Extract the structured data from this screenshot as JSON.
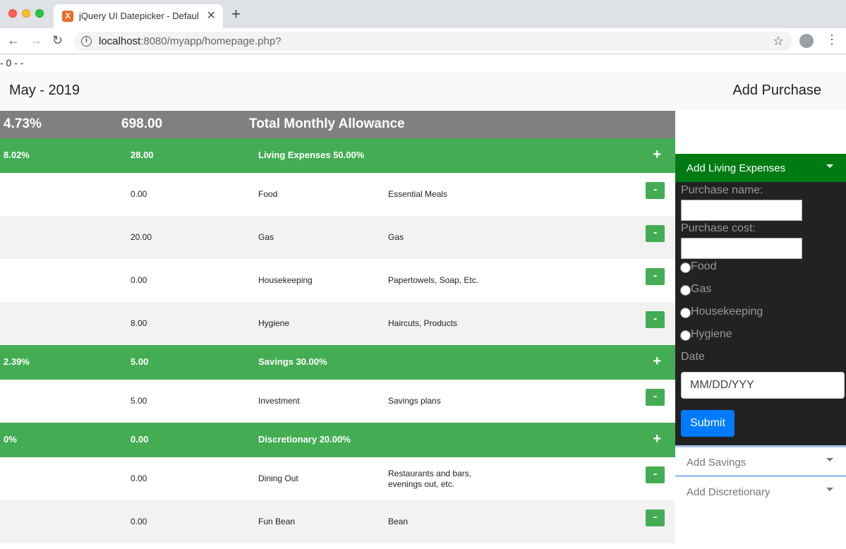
{
  "browser": {
    "tab_title": "jQuery UI Datepicker - Default f",
    "tab_favicon": "X",
    "url_host": "localhost",
    "url_path": ":8080/myapp/homepage.php?"
  },
  "page": {
    "top_text": "- 0 - -",
    "month": "May - 2019",
    "add_purchase": "Add Purchase"
  },
  "total": {
    "percent": "4.73%",
    "amount": "698.00",
    "label": "Total Monthly Allowance"
  },
  "categories": [
    {
      "percent": "8.02%",
      "amount": "28.00",
      "label": "Living Expenses 50.00%",
      "plus": "+",
      "items": [
        {
          "amount": "0.00",
          "name": "Food",
          "desc": "Essential Meals",
          "minus": "-"
        },
        {
          "amount": "20.00",
          "name": "Gas",
          "desc": "Gas",
          "minus": "-"
        },
        {
          "amount": "0.00",
          "name": "Housekeeping",
          "desc": "Papertowels, Soap, Etc.",
          "minus": "-"
        },
        {
          "amount": "8.00",
          "name": "Hygiene",
          "desc": "Haircuts, Products",
          "minus": "-"
        }
      ]
    },
    {
      "percent": "2.39%",
      "amount": "5.00",
      "label": "Savings 30.00%",
      "plus": "+",
      "items": [
        {
          "amount": "5.00",
          "name": "Investment",
          "desc": "Savings plans",
          "minus": "-"
        }
      ]
    },
    {
      "percent": "0%",
      "amount": "0.00",
      "label": "Discretionary 20.00%",
      "plus": "+",
      "items": [
        {
          "amount": "0.00",
          "name": "Dining Out",
          "desc_line1": "Restaurants and bars,",
          "desc_line2": "evenings out, etc.",
          "minus": "-"
        },
        {
          "amount": "0.00",
          "name": "Fun Bean",
          "desc": "Bean",
          "minus": "-"
        }
      ]
    }
  ],
  "sidebar": {
    "active_header": "Add Living Expenses",
    "purchase_name_label": "Purchase name:",
    "purchase_name_value": "",
    "purchase_cost_label": "Purchase cost:",
    "purchase_cost_value": "",
    "radios": [
      "Food",
      "Gas",
      "Housekeeping",
      "Hygiene"
    ],
    "date_label": "Date",
    "date_placeholder": "MM/DD/YYY",
    "submit": "Submit",
    "savings_header": "Add Savings",
    "discretionary_header": "Add Discretionary"
  },
  "colors": {
    "category_green": "#44ad54",
    "active_header_green": "#007b14",
    "total_gray": "#808080",
    "submit_blue": "#007bff"
  }
}
